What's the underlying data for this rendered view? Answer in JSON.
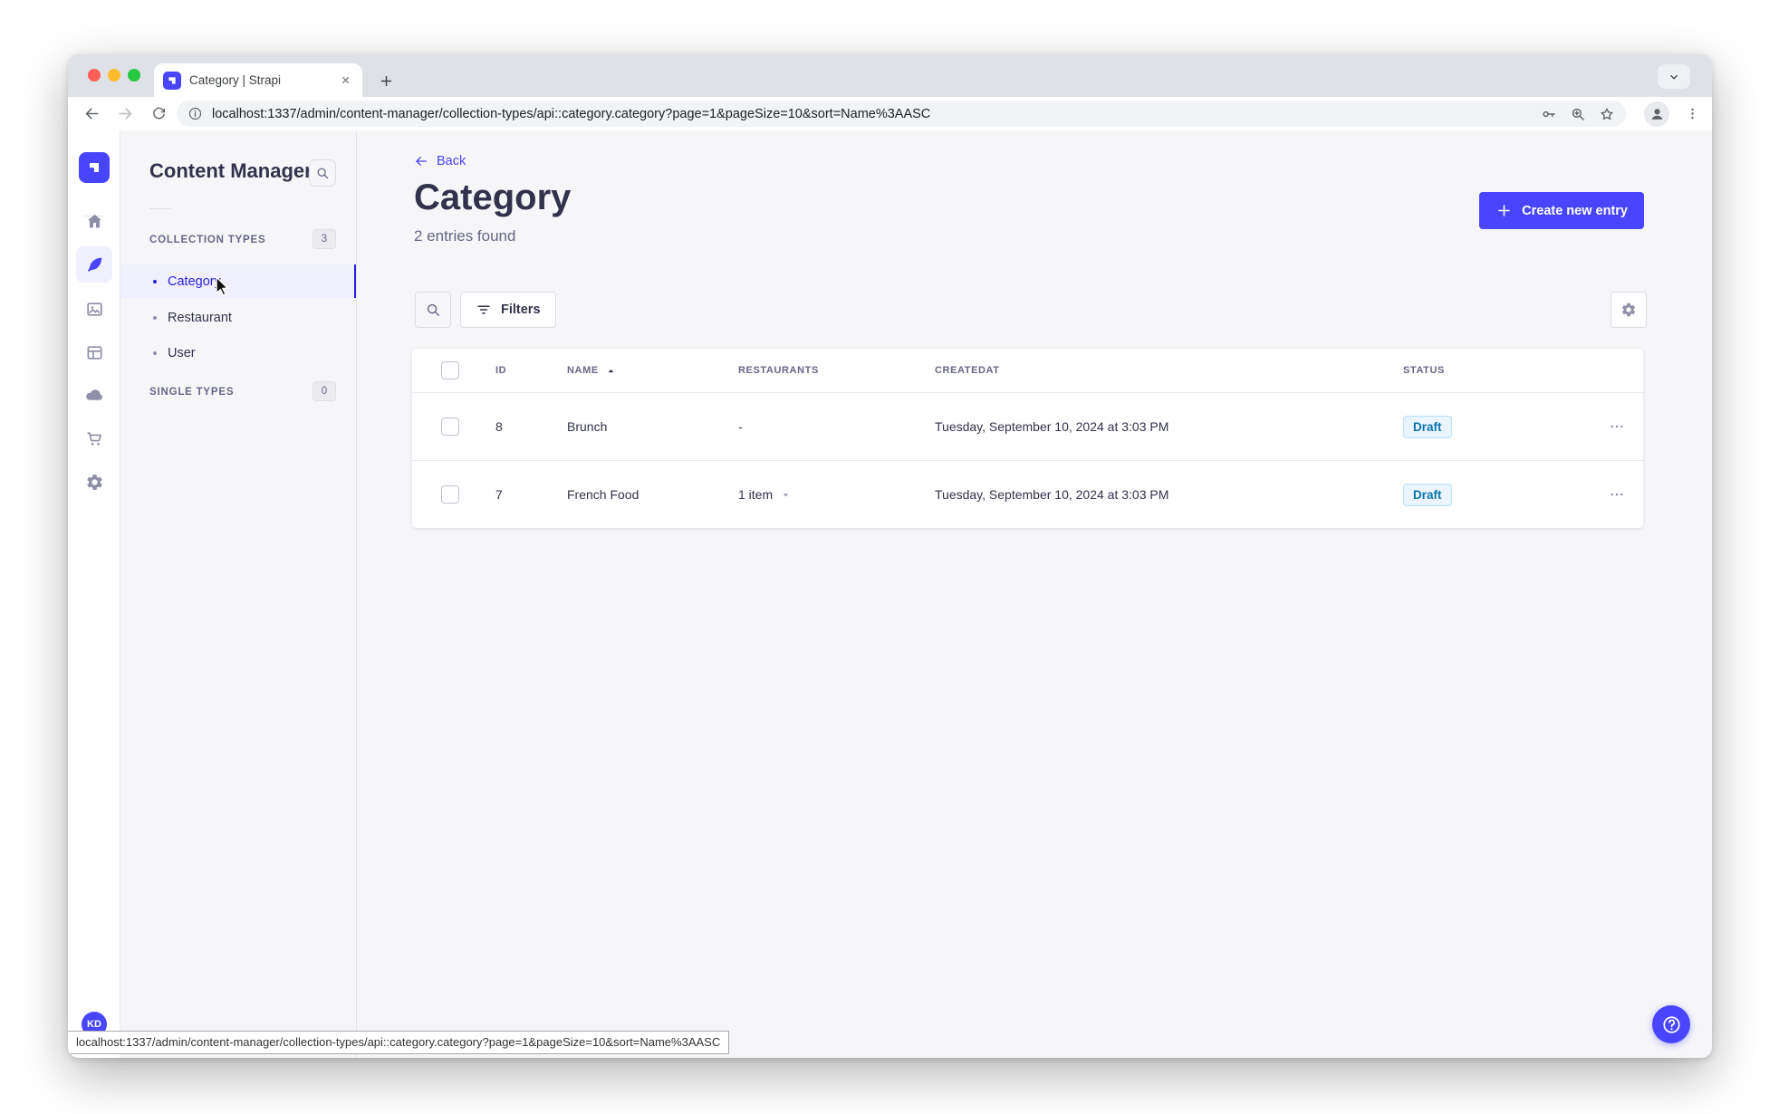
{
  "colors": {
    "accent": "#4945ff",
    "selected_text": "#271fe0",
    "draft_bg": "#eaf5ff",
    "draft_border": "#b8e1ff",
    "draft_text": "#0c75af",
    "panel_bg": "#f6f6f9"
  },
  "browser": {
    "tab_title": "Category | Strapi",
    "url": "localhost:1337/admin/content-manager/collection-types/api::category.category?page=1&pageSize=10&sort=Name%3AASC"
  },
  "subnav": {
    "title": "Content Manager",
    "sections": [
      {
        "label": "COLLECTION TYPES",
        "count": "3",
        "items": [
          {
            "label": "Category"
          },
          {
            "label": "Restaurant"
          },
          {
            "label": "User"
          }
        ]
      },
      {
        "label": "SINGLE TYPES",
        "count": "0",
        "items": []
      }
    ]
  },
  "main": {
    "back_label": "Back",
    "title": "Category",
    "subtitle": "2 entries found",
    "create_button_label": "Create new entry",
    "filters_button_label": "Filters",
    "table": {
      "headers": [
        "ID",
        "NAME",
        "RESTAURANTS",
        "CREATEDAT",
        "STATUS"
      ],
      "rows": [
        {
          "id": "8",
          "name": "Brunch",
          "restaurants": "-",
          "createdat": "Tuesday, September 10, 2024 at 3:03 PM",
          "status": "Draft"
        },
        {
          "id": "7",
          "name": "French Food",
          "restaurants": "1 item",
          "createdat": "Tuesday, September 10, 2024 at 3:03 PM",
          "status": "Draft"
        }
      ]
    }
  },
  "statusbar": {
    "url": "localhost:1337/admin/content-manager/collection-types/api::category.category?page=1&pageSize=10&sort=Name%3AASC"
  },
  "user": {
    "initials": "KD"
  }
}
